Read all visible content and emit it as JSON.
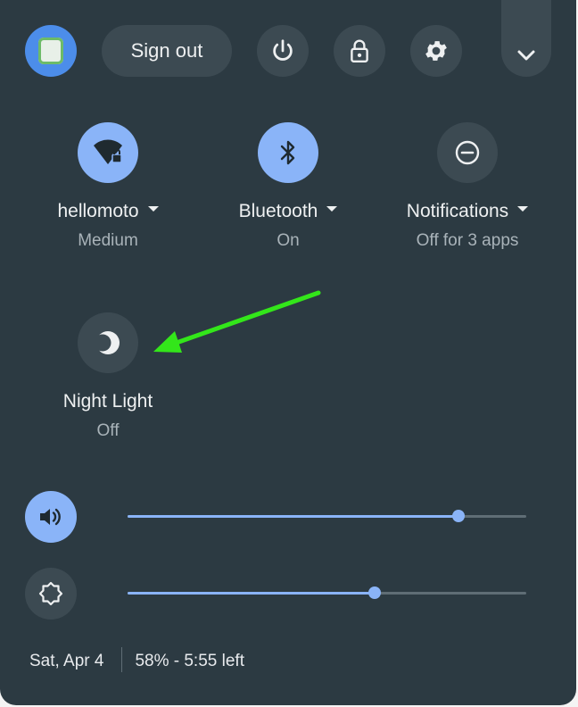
{
  "header": {
    "sign_out_label": "Sign out",
    "icons": [
      "avatar",
      "power-icon",
      "lock-icon",
      "gear-icon",
      "chevron-down-icon"
    ]
  },
  "tiles": [
    {
      "label": "hellomoto",
      "sub": "Medium",
      "state": "on",
      "icon": "wifi-locked-icon",
      "has_menu": true
    },
    {
      "label": "Bluetooth",
      "sub": "On",
      "state": "on",
      "icon": "bluetooth-icon",
      "has_menu": true
    },
    {
      "label": "Notifications",
      "sub": "Off for 3 apps",
      "state": "off",
      "icon": "do-not-disturb-icon",
      "has_menu": true
    },
    {
      "label": "Night Light",
      "sub": "Off",
      "state": "off",
      "icon": "night-light-icon",
      "has_menu": false
    }
  ],
  "sliders": {
    "volume": {
      "icon": "volume-icon",
      "level": 0.83
    },
    "brightness": {
      "icon": "brightness-icon",
      "level": 0.62
    }
  },
  "footer": {
    "date": "Sat, Apr 4",
    "battery": "58% - 5:55 left"
  },
  "colors": {
    "panel_bg": "#2c3a42",
    "button_bg": "#3c4a52",
    "accent": "#8ab4f8",
    "annotation_arrow": "#33e61a"
  }
}
